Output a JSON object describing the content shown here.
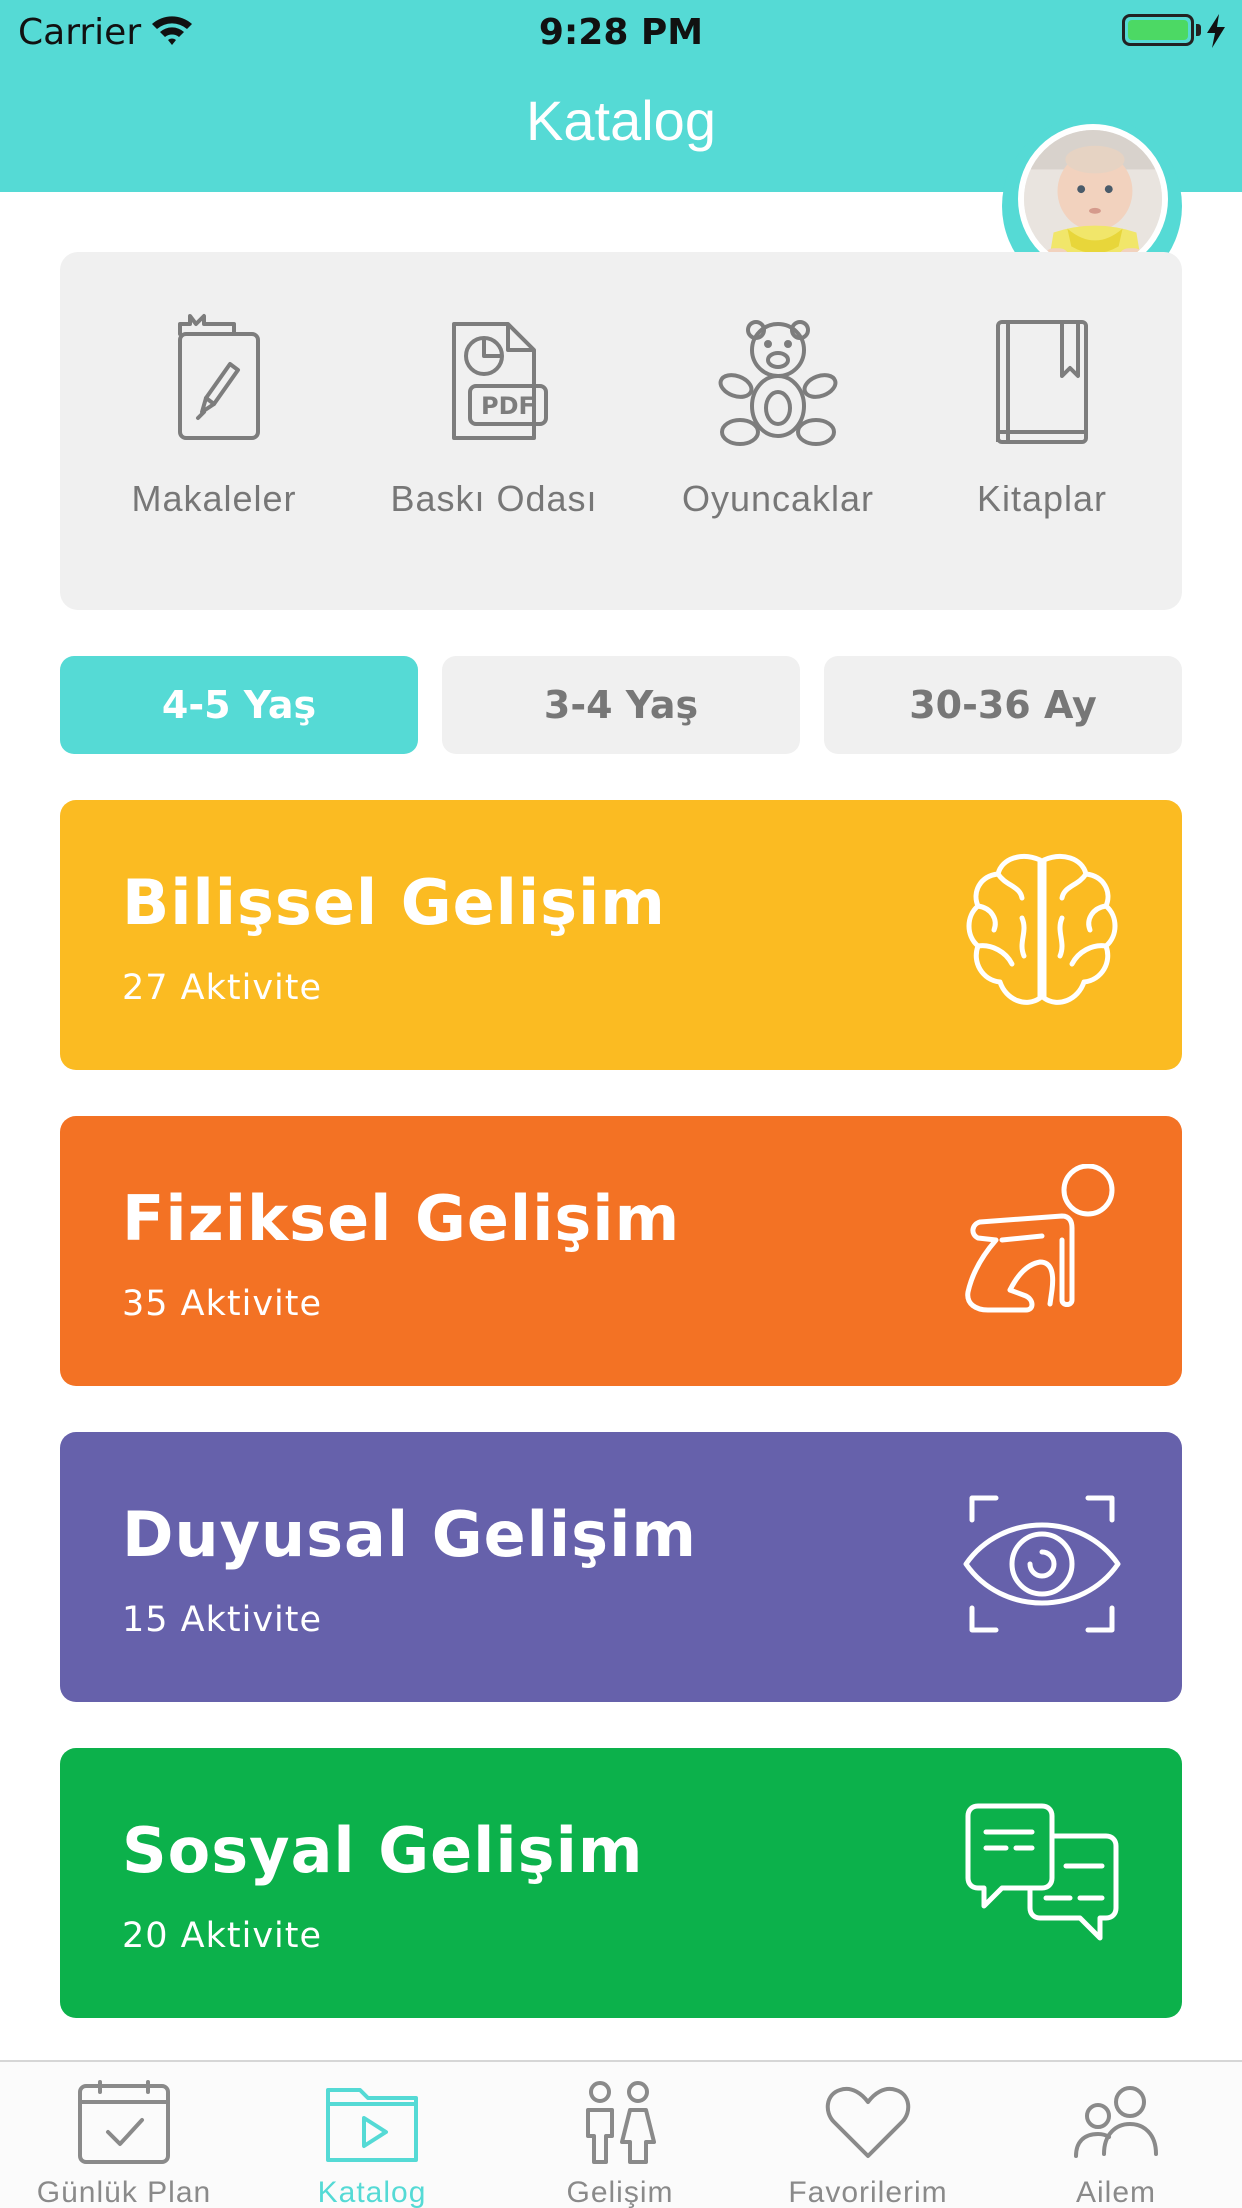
{
  "status_bar": {
    "carrier": "Carrier",
    "time": "9:28 PM"
  },
  "header": {
    "title": "Katalog"
  },
  "categories": [
    {
      "label": "Makaleler",
      "icon": "article-icon"
    },
    {
      "label": "Baskı Odası",
      "icon": "pdf-icon"
    },
    {
      "label": "Oyuncaklar",
      "icon": "teddy-bear-icon"
    },
    {
      "label": "Kitaplar",
      "icon": "book-icon"
    }
  ],
  "age_tabs": [
    {
      "label": "4-5 Yaş",
      "active": true
    },
    {
      "label": "3-4 Yaş",
      "active": false
    },
    {
      "label": "30-36 Ay",
      "active": false
    }
  ],
  "cards": [
    {
      "title": "Bilişsel Gelişim",
      "subtitle": "27 Aktivite",
      "color": "#fbbb22",
      "icon": "brain-icon"
    },
    {
      "title": "Fiziksel Gelişim",
      "subtitle": "35 Aktivite",
      "color": "#f37224",
      "icon": "crawling-baby-icon"
    },
    {
      "title": "Duyusal Gelişim",
      "subtitle": "15 Aktivite",
      "color": "#6661ab",
      "icon": "eye-icon"
    },
    {
      "title": "Sosyal Gelişim",
      "subtitle": "20 Aktivite",
      "color": "#0cb14b",
      "icon": "chat-bubbles-icon"
    }
  ],
  "tabbar": [
    {
      "label": "Günlük Plan",
      "icon": "calendar-check-icon",
      "active": false
    },
    {
      "label": "Katalog",
      "icon": "folder-play-icon",
      "active": true
    },
    {
      "label": "Gelişim",
      "icon": "people-icon",
      "active": false
    },
    {
      "label": "Favorilerim",
      "icon": "heart-icon",
      "active": false
    },
    {
      "label": "Ailem",
      "icon": "family-icon",
      "active": false
    }
  ],
  "colors": {
    "accent": "#55dad5",
    "inactive": "#8a8a8a",
    "box_bg": "#f0f0f0"
  }
}
